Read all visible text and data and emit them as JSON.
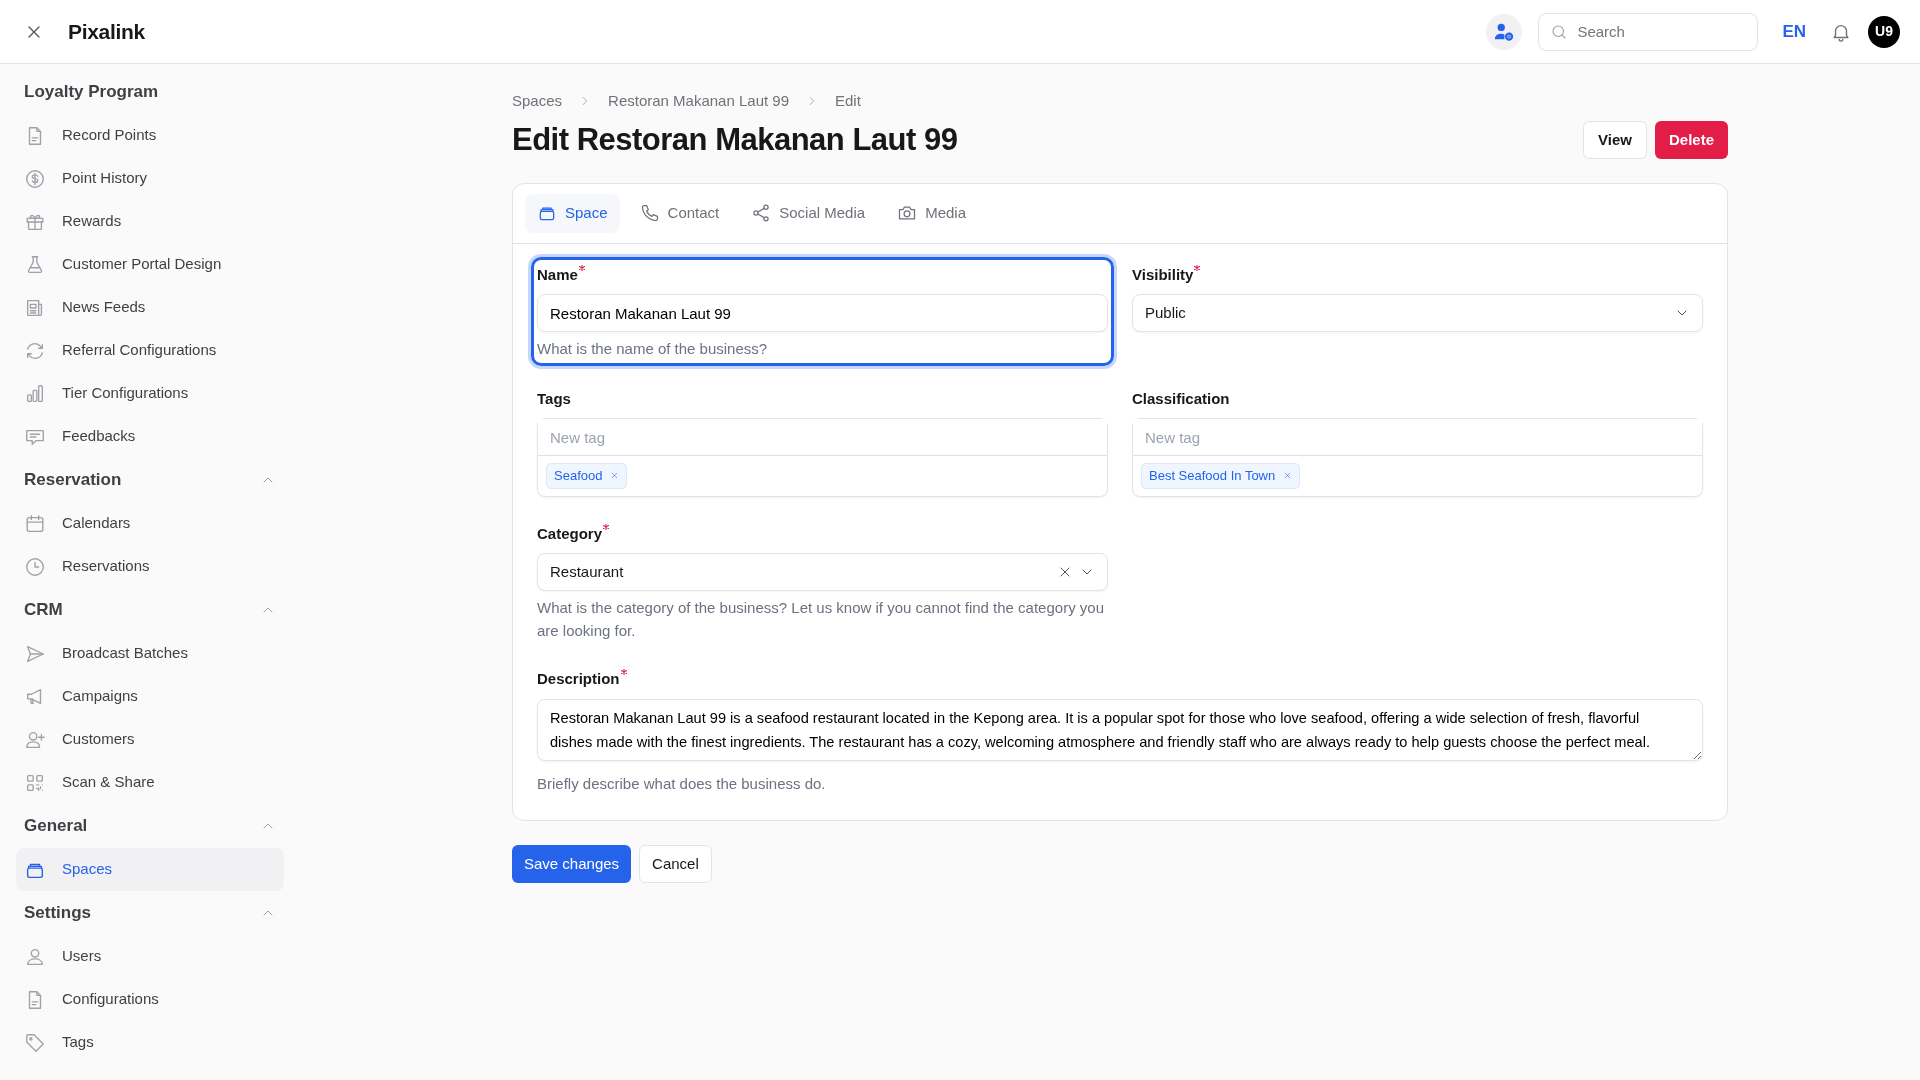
{
  "app": {
    "title": "Pixalink"
  },
  "topbar": {
    "search": {
      "placeholder": "Search"
    },
    "language": "EN",
    "avatar": "U9"
  },
  "sidebar": {
    "groups": [
      {
        "title": "Loyalty Program",
        "items": [
          {
            "label": "Record Points",
            "selected": false
          },
          {
            "label": "Point History",
            "selected": false
          },
          {
            "label": "Rewards",
            "selected": false
          },
          {
            "label": "Customer Portal Design",
            "selected": false
          },
          {
            "label": "News Feeds",
            "selected": false
          },
          {
            "label": "Referral Configurations",
            "selected": false
          },
          {
            "label": "Tier Configurations",
            "selected": false
          },
          {
            "label": "Feedbacks",
            "selected": false
          }
        ]
      },
      {
        "title": "Reservation",
        "expanded": true,
        "items": [
          {
            "label": "Calendars",
            "selected": false
          },
          {
            "label": "Reservations",
            "selected": false
          }
        ]
      },
      {
        "title": "CRM",
        "expanded": true,
        "items": [
          {
            "label": "Broadcast Batches",
            "selected": false
          },
          {
            "label": "Campaigns",
            "selected": false
          },
          {
            "label": "Customers",
            "selected": false
          },
          {
            "label": "Scan & Share",
            "selected": false
          }
        ]
      },
      {
        "title": "General",
        "expanded": true,
        "items": [
          {
            "label": "Spaces",
            "selected": true
          }
        ]
      },
      {
        "title": "Settings",
        "expanded": true,
        "items": [
          {
            "label": "Users",
            "selected": false
          },
          {
            "label": "Configurations",
            "selected": false
          },
          {
            "label": "Tags",
            "selected": false
          }
        ]
      }
    ]
  },
  "breadcrumb": [
    "Spaces",
    "Restoran Makanan Laut 99",
    "Edit"
  ],
  "page_title": "Edit Restoran Makanan Laut 99",
  "actions": [
    {
      "label": "View",
      "kind": "secondary"
    },
    {
      "label": "Delete",
      "kind": "danger"
    }
  ],
  "tabs": [
    {
      "label": "Space",
      "selected": true
    },
    {
      "label": "Contact",
      "selected": false
    },
    {
      "label": "Social Media",
      "selected": false
    },
    {
      "label": "Media",
      "selected": false
    }
  ],
  "fields": [
    {
      "kind": "text",
      "label": "Name",
      "required": true,
      "focused": true,
      "value": "Restoran Makanan Laut 99",
      "hint": "What is the name of the business?"
    },
    {
      "kind": "select",
      "label": "Visibility",
      "required": true,
      "value": "Public"
    },
    {
      "kind": "tags",
      "label": "Tags",
      "placeholder": "New tag",
      "tags": [
        "Seafood"
      ]
    },
    {
      "kind": "tags",
      "label": "Classification",
      "placeholder": "New tag",
      "tags": [
        "Best Seafood In Town"
      ]
    },
    {
      "kind": "select",
      "label": "Category",
      "required": true,
      "clearable": true,
      "value": "Restaurant",
      "hint": "What is the category of the business? Let us know if you cannot find the category you are looking for."
    },
    {
      "kind": "textarea",
      "label": "Description",
      "required": true,
      "value": "Restoran Makanan Laut 99 is a seafood restaurant located in the Kepong area. It is a popular spot for those who love seafood, offering a wide selection of fresh, flavorful dishes made with the finest ingredients. The restaurant has a cozy, welcoming atmosphere and friendly staff who are always ready to help guests choose the perfect meal.",
      "hint": "Briefly describe what does the business do."
    }
  ],
  "footer_buttons": [
    {
      "label": "Save changes",
      "kind": "primary"
    },
    {
      "label": "Cancel",
      "kind": "secondary"
    }
  ]
}
